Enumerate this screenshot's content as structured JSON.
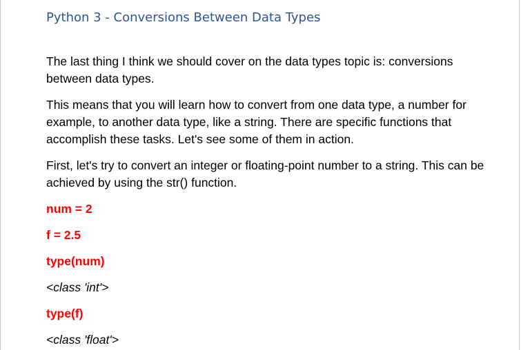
{
  "document": {
    "title": "Python 3 - Conversions Between Data Types",
    "paragraphs": [
      "The last thing I think we should cover on the data types topic is: conversions between data types.",
      "This means that you will learn how to convert from one data type, a number for example, to another data type, like a string. There are specific functions that accomplish these tasks. Let's see some of them in action.",
      "First, let's try to convert an integer or floating-point number to a string. This can be achieved by using the str() function."
    ],
    "code_lines": [
      "num = 2",
      "f = 2.5",
      "type(num)",
      "<class 'int'>",
      "type(f)",
      "<class 'float'>"
    ]
  },
  "colors": {
    "title": "#2f5496",
    "code": "#ff0000",
    "text": "#000000"
  }
}
